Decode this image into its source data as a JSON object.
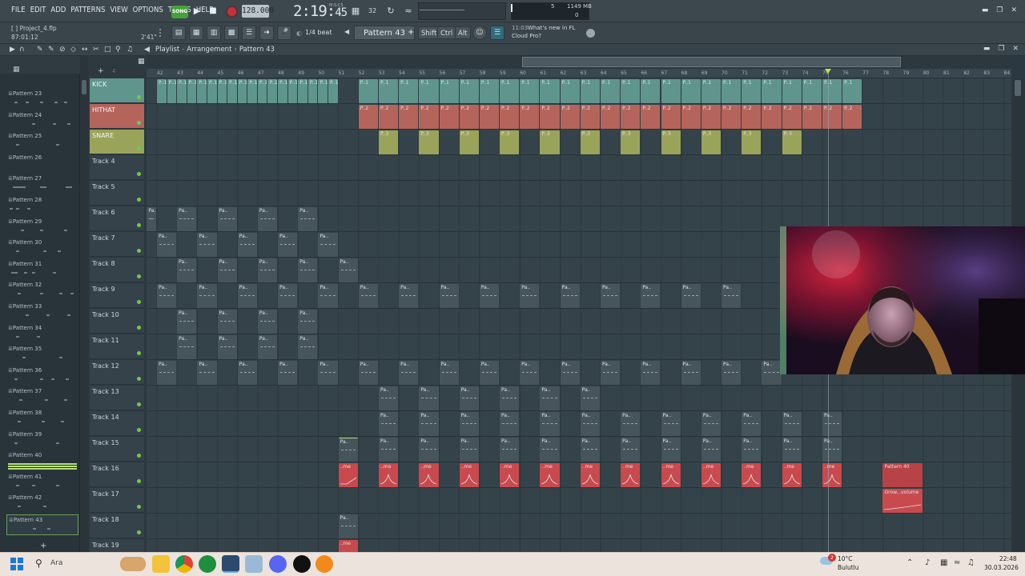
{
  "menu": [
    "FILE",
    "EDIT",
    "ADD",
    "PATTERNS",
    "VIEW",
    "OPTIONS",
    "TOOLS",
    "HELP"
  ],
  "transport": {
    "song_label": "SONG",
    "tempo": "128.000",
    "time": "2:19",
    "time_fraction": "45",
    "time_unit": "M:S:CS",
    "cpu": "5",
    "memory": "1149 MB",
    "polyphony": "0"
  },
  "project": {
    "name": "Project_4.flp",
    "position": "87:01:12",
    "length": "2'41\""
  },
  "toolbar2": {
    "snap": "1/4 beat",
    "pattern": "Pattern 43",
    "key_shift": "Shift",
    "key_ctrl": "Ctrl",
    "key_alt": "Alt",
    "news_time": "11:03",
    "news_title": "What's new in FL",
    "news_sub": "Cloud Pro?"
  },
  "playlist": {
    "title": "Playlist",
    "section": "Arrangement",
    "pattern": "Pattern 43"
  },
  "bars": [
    "42",
    "43",
    "44",
    "45",
    "46",
    "47",
    "48",
    "49",
    "50",
    "51",
    "52",
    "53",
    "54",
    "55",
    "56",
    "57",
    "58",
    "59",
    "60",
    "61",
    "62",
    "63",
    "64",
    "65",
    "66",
    "67",
    "68",
    "69",
    "70",
    "71",
    "72",
    "73",
    "74",
    "75",
    "76",
    "77",
    "78",
    "79",
    "80",
    "81",
    "82",
    "83",
    "84"
  ],
  "patterns": [
    {
      "name": "Pattern 23"
    },
    {
      "name": "Pattern 24"
    },
    {
      "name": "Pattern 25"
    },
    {
      "name": "Pattern 26"
    },
    {
      "name": "Pattern 27"
    },
    {
      "name": "Pattern 28"
    },
    {
      "name": "Pattern 29"
    },
    {
      "name": "Pattern 30"
    },
    {
      "name": "Pattern 31"
    },
    {
      "name": "Pattern 32"
    },
    {
      "name": "Pattern 33"
    },
    {
      "name": "Pattern 34"
    },
    {
      "name": "Pattern 35"
    },
    {
      "name": "Pattern 36"
    },
    {
      "name": "Pattern 37"
    },
    {
      "name": "Pattern 38"
    },
    {
      "name": "Pattern 39"
    },
    {
      "name": "Pattern 40"
    },
    {
      "name": "Pattern 41"
    },
    {
      "name": "Pattern 42"
    },
    {
      "name": "Pattern 43"
    }
  ],
  "tracks": [
    {
      "name": "KICK",
      "color": "#5f958c"
    },
    {
      "name": "HITHAT",
      "color": "#b5645c"
    },
    {
      "name": "SNARE",
      "color": "#9aa35a"
    },
    {
      "name": "Track 4"
    },
    {
      "name": "Track 5"
    },
    {
      "name": "Track 6"
    },
    {
      "name": "Track 7"
    },
    {
      "name": "Track 8"
    },
    {
      "name": "Track 9"
    },
    {
      "name": "Track 10"
    },
    {
      "name": "Track 11"
    },
    {
      "name": "Track 12"
    },
    {
      "name": "Track 13"
    },
    {
      "name": "Track 14"
    },
    {
      "name": "Track 15"
    },
    {
      "name": "Track 16"
    },
    {
      "name": "Track 17"
    },
    {
      "name": "Track 18"
    },
    {
      "name": "Track 19"
    }
  ],
  "clip_labels": {
    "kick": "P..1",
    "hihat": "P..2",
    "snare": "P..3",
    "generic": "Pa..",
    "auto": "..me",
    "pattern40": "Pattern 40",
    "grow_volume": "Grow...volume"
  },
  "taskbar": {
    "search": "Ara",
    "weather_temp": "10°C",
    "weather_desc": "Bulutlu",
    "time": "22:48",
    "date": "30.03.2026",
    "notification_count": "2"
  },
  "colors": {
    "kick": "#5f958c",
    "hihat": "#b5645c",
    "snare": "#9aa35a",
    "clip_generic": "#46555c",
    "automation": "#c84a4e",
    "accent_green": "#71c84f"
  }
}
